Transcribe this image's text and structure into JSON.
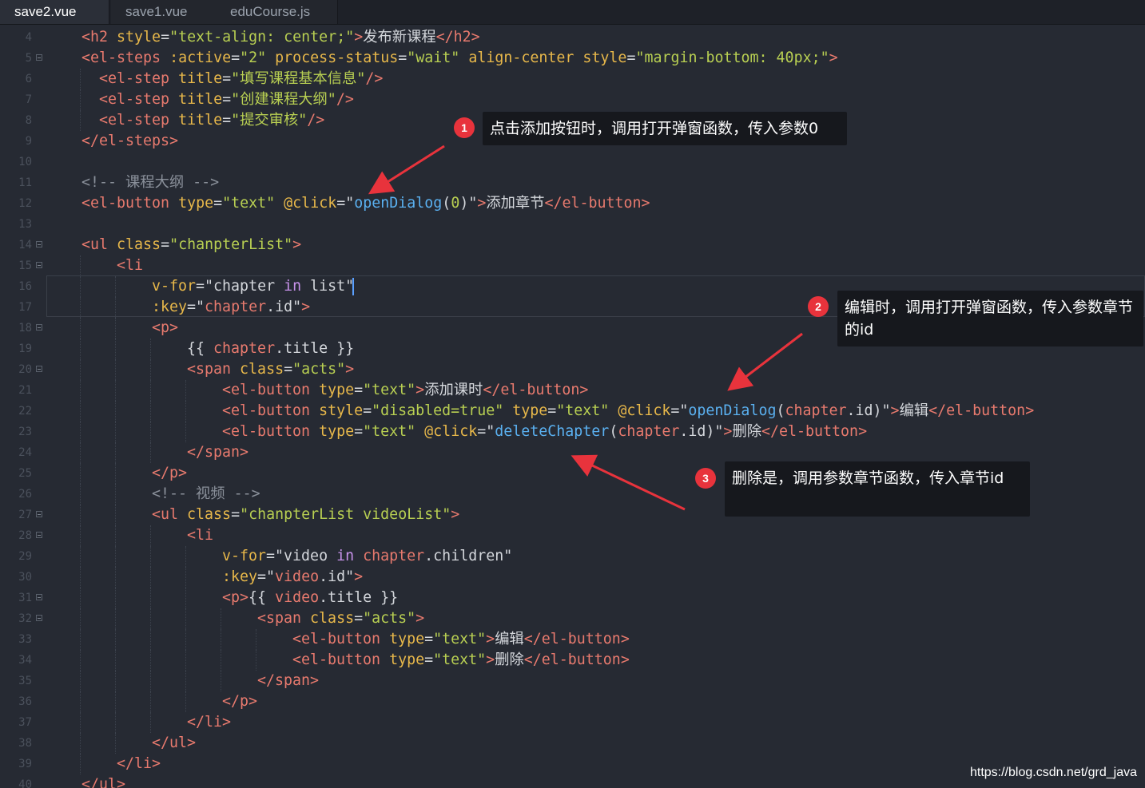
{
  "tabs": [
    {
      "label": "save2.vue",
      "active": true
    },
    {
      "label": "save1.vue",
      "active": false
    },
    {
      "label": "eduCourse.js",
      "active": false
    }
  ],
  "colors": {
    "tag": "#e87a6e",
    "attr": "#e8b84a",
    "string": "#b8cf52",
    "text": "#d4d7dc",
    "comment": "#8a909a",
    "func": "#5ab0f0",
    "keyword": "#c792ea",
    "var": "#e87a6e"
  },
  "code_lines": [
    {
      "n": "4",
      "fold": false,
      "indent": 1,
      "tokens": [
        [
          "tag",
          "<h2 "
        ],
        [
          "attr",
          "style"
        ],
        [
          "text",
          "="
        ],
        [
          "string",
          "\"text-align: center;\""
        ],
        [
          "tag",
          ">"
        ],
        [
          "text",
          "发布新课程"
        ],
        [
          "tag",
          "</h2>"
        ]
      ]
    },
    {
      "n": "5",
      "fold": true,
      "indent": 1,
      "tokens": [
        [
          "tag",
          "<el-steps "
        ],
        [
          "attr",
          ":active"
        ],
        [
          "text",
          "="
        ],
        [
          "string",
          "\"2\" "
        ],
        [
          "attr",
          "process-status"
        ],
        [
          "text",
          "="
        ],
        [
          "string",
          "\"wait\" "
        ],
        [
          "attr",
          "align-center "
        ],
        [
          "attr",
          "style"
        ],
        [
          "text",
          "="
        ],
        [
          "string",
          "\"margin-bottom: 40px;\""
        ],
        [
          "tag",
          ">"
        ]
      ]
    },
    {
      "n": "6",
      "fold": false,
      "indent": 2,
      "tokens": [
        [
          "tag",
          "<el-step "
        ],
        [
          "attr",
          "title"
        ],
        [
          "text",
          "="
        ],
        [
          "string",
          "\"填写课程基本信息\""
        ],
        [
          "tag",
          "/>"
        ]
      ]
    },
    {
      "n": "7",
      "fold": false,
      "indent": 2,
      "tokens": [
        [
          "tag",
          "<el-step "
        ],
        [
          "attr",
          "title"
        ],
        [
          "text",
          "="
        ],
        [
          "string",
          "\"创建课程大纲\""
        ],
        [
          "tag",
          "/>"
        ]
      ]
    },
    {
      "n": "8",
      "fold": false,
      "indent": 2,
      "tokens": [
        [
          "tag",
          "<el-step "
        ],
        [
          "attr",
          "title"
        ],
        [
          "text",
          "="
        ],
        [
          "string",
          "\"提交审核\""
        ],
        [
          "tag",
          "/>"
        ]
      ]
    },
    {
      "n": "9",
      "fold": false,
      "indent": 1,
      "tokens": [
        [
          "tag",
          "</el-steps>"
        ]
      ]
    },
    {
      "n": "10",
      "fold": false,
      "indent": 1,
      "tokens": []
    },
    {
      "n": "11",
      "fold": false,
      "indent": 1,
      "tokens": [
        [
          "comment",
          "<!-- 课程大纲 -->"
        ]
      ]
    },
    {
      "n": "12",
      "fold": false,
      "indent": 1,
      "tokens": [
        [
          "tag",
          "<el-button "
        ],
        [
          "attr",
          "type"
        ],
        [
          "text",
          "="
        ],
        [
          "string",
          "\"text\" "
        ],
        [
          "attr",
          "@click"
        ],
        [
          "text",
          "=\""
        ],
        [
          "func",
          "openDialog"
        ],
        [
          "text",
          "("
        ],
        [
          "string",
          "0"
        ],
        [
          "text",
          ")\""
        ],
        [
          "tag",
          ">"
        ],
        [
          "text",
          "添加章节"
        ],
        [
          "tag",
          "</el-button>"
        ]
      ]
    },
    {
      "n": "13",
      "fold": false,
      "indent": 1,
      "tokens": []
    },
    {
      "n": "14",
      "fold": true,
      "indent": 1,
      "tokens": [
        [
          "tag",
          "<ul "
        ],
        [
          "attr",
          "class"
        ],
        [
          "text",
          "="
        ],
        [
          "string",
          "\"chanpterList\""
        ],
        [
          "tag",
          ">"
        ]
      ]
    },
    {
      "n": "15",
      "fold": true,
      "indent": 3,
      "tokens": [
        [
          "tag",
          "<li"
        ]
      ]
    },
    {
      "n": "16",
      "fold": false,
      "indent": 5,
      "tokens": [
        [
          "attr",
          "v-for"
        ],
        [
          "text",
          "=\"chapter "
        ],
        [
          "keyword",
          "in"
        ],
        [
          "text",
          " list\""
        ]
      ]
    },
    {
      "n": "17",
      "fold": false,
      "indent": 5,
      "tokens": [
        [
          "attr",
          ":key"
        ],
        [
          "text",
          "=\""
        ],
        [
          "var",
          "chapter"
        ],
        [
          "text",
          ".id\""
        ],
        [
          "tag",
          ">"
        ]
      ]
    },
    {
      "n": "18",
      "fold": true,
      "indent": 5,
      "tokens": [
        [
          "tag",
          "<p>"
        ]
      ]
    },
    {
      "n": "19",
      "fold": false,
      "indent": 7,
      "tokens": [
        [
          "text",
          "{{ "
        ],
        [
          "var",
          "chapter"
        ],
        [
          "text",
          ".title }}"
        ]
      ]
    },
    {
      "n": "20",
      "fold": true,
      "indent": 7,
      "tokens": [
        [
          "tag",
          "<span "
        ],
        [
          "attr",
          "class"
        ],
        [
          "text",
          "="
        ],
        [
          "string",
          "\"acts\""
        ],
        [
          "tag",
          ">"
        ]
      ]
    },
    {
      "n": "21",
      "fold": false,
      "indent": 9,
      "tokens": [
        [
          "tag",
          "<el-button "
        ],
        [
          "attr",
          "type"
        ],
        [
          "text",
          "="
        ],
        [
          "string",
          "\"text\""
        ],
        [
          "tag",
          ">"
        ],
        [
          "text",
          "添加课时"
        ],
        [
          "tag",
          "</el-button>"
        ]
      ]
    },
    {
      "n": "22",
      "fold": false,
      "indent": 9,
      "tokens": [
        [
          "tag",
          "<el-button "
        ],
        [
          "attr",
          "style"
        ],
        [
          "text",
          "="
        ],
        [
          "string",
          "\"disabled=true\" "
        ],
        [
          "attr",
          "type"
        ],
        [
          "text",
          "="
        ],
        [
          "string",
          "\"text\" "
        ],
        [
          "attr",
          "@click"
        ],
        [
          "text",
          "=\""
        ],
        [
          "func",
          "openDialog"
        ],
        [
          "text",
          "("
        ],
        [
          "var",
          "chapter"
        ],
        [
          "text",
          ".id)\""
        ],
        [
          "tag",
          ">"
        ],
        [
          "text",
          "编辑"
        ],
        [
          "tag",
          "</el-button>"
        ]
      ]
    },
    {
      "n": "23",
      "fold": false,
      "indent": 9,
      "tokens": [
        [
          "tag",
          "<el-button "
        ],
        [
          "attr",
          "type"
        ],
        [
          "text",
          "="
        ],
        [
          "string",
          "\"text\" "
        ],
        [
          "attr",
          "@click"
        ],
        [
          "text",
          "=\""
        ],
        [
          "func",
          "deleteChapter"
        ],
        [
          "text",
          "("
        ],
        [
          "var",
          "chapter"
        ],
        [
          "text",
          ".id)\""
        ],
        [
          "tag",
          ">"
        ],
        [
          "text",
          "删除"
        ],
        [
          "tag",
          "</el-button>"
        ]
      ]
    },
    {
      "n": "24",
      "fold": false,
      "indent": 7,
      "tokens": [
        [
          "tag",
          "</span>"
        ]
      ]
    },
    {
      "n": "25",
      "fold": false,
      "indent": 5,
      "tokens": [
        [
          "tag",
          "</p>"
        ]
      ]
    },
    {
      "n": "26",
      "fold": false,
      "indent": 5,
      "tokens": [
        [
          "comment",
          "<!-- 视频 -->"
        ]
      ]
    },
    {
      "n": "27",
      "fold": true,
      "indent": 5,
      "tokens": [
        [
          "tag",
          "<ul "
        ],
        [
          "attr",
          "class"
        ],
        [
          "text",
          "="
        ],
        [
          "string",
          "\"chanpterList videoList\""
        ],
        [
          "tag",
          ">"
        ]
      ]
    },
    {
      "n": "28",
      "fold": true,
      "indent": 7,
      "tokens": [
        [
          "tag",
          "<li"
        ]
      ]
    },
    {
      "n": "29",
      "fold": false,
      "indent": 9,
      "tokens": [
        [
          "attr",
          "v-for"
        ],
        [
          "text",
          "=\"video "
        ],
        [
          "keyword",
          "in"
        ],
        [
          "text",
          " "
        ],
        [
          "var",
          "chapter"
        ],
        [
          "text",
          ".children\""
        ]
      ]
    },
    {
      "n": "30",
      "fold": false,
      "indent": 9,
      "tokens": [
        [
          "attr",
          ":key"
        ],
        [
          "text",
          "=\""
        ],
        [
          "var",
          "video"
        ],
        [
          "text",
          ".id\""
        ],
        [
          "tag",
          ">"
        ]
      ]
    },
    {
      "n": "31",
      "fold": true,
      "indent": 9,
      "tokens": [
        [
          "tag",
          "<p>"
        ],
        [
          "text",
          "{{ "
        ],
        [
          "var",
          "video"
        ],
        [
          "text",
          ".title }}"
        ]
      ]
    },
    {
      "n": "32",
      "fold": true,
      "indent": 11,
      "tokens": [
        [
          "tag",
          "<span "
        ],
        [
          "attr",
          "class"
        ],
        [
          "text",
          "="
        ],
        [
          "string",
          "\"acts\""
        ],
        [
          "tag",
          ">"
        ]
      ]
    },
    {
      "n": "33",
      "fold": false,
      "indent": 13,
      "tokens": [
        [
          "tag",
          "<el-button "
        ],
        [
          "attr",
          "type"
        ],
        [
          "text",
          "="
        ],
        [
          "string",
          "\"text\""
        ],
        [
          "tag",
          ">"
        ],
        [
          "text",
          "编辑"
        ],
        [
          "tag",
          "</el-button>"
        ]
      ]
    },
    {
      "n": "34",
      "fold": false,
      "indent": 13,
      "tokens": [
        [
          "tag",
          "<el-button "
        ],
        [
          "attr",
          "type"
        ],
        [
          "text",
          "="
        ],
        [
          "string",
          "\"text\""
        ],
        [
          "tag",
          ">"
        ],
        [
          "text",
          "删除"
        ],
        [
          "tag",
          "</el-button>"
        ]
      ]
    },
    {
      "n": "35",
      "fold": false,
      "indent": 11,
      "tokens": [
        [
          "tag",
          "</span>"
        ]
      ]
    },
    {
      "n": "36",
      "fold": false,
      "indent": 9,
      "tokens": [
        [
          "tag",
          "</p>"
        ]
      ]
    },
    {
      "n": "37",
      "fold": false,
      "indent": 7,
      "tokens": [
        [
          "tag",
          "</li>"
        ]
      ]
    },
    {
      "n": "38",
      "fold": false,
      "indent": 5,
      "tokens": [
        [
          "tag",
          "</ul>"
        ]
      ]
    },
    {
      "n": "39",
      "fold": false,
      "indent": 3,
      "tokens": [
        [
          "tag",
          "</li>"
        ]
      ]
    },
    {
      "n": "40",
      "fold": false,
      "indent": 1,
      "tokens": [
        [
          "tag",
          "</ul>"
        ]
      ]
    }
  ],
  "callouts": [
    {
      "number": "1",
      "text": "点击添加按钮时，调用打开弹窗函数，传入参数0"
    },
    {
      "number": "2",
      "text": "编辑时，调用打开弹窗函数，传入参数章节的id"
    },
    {
      "number": "3",
      "text": "删除是，调用参数章节函数，传入章节id"
    }
  ],
  "watermark": "https://blog.csdn.net/grd_java"
}
